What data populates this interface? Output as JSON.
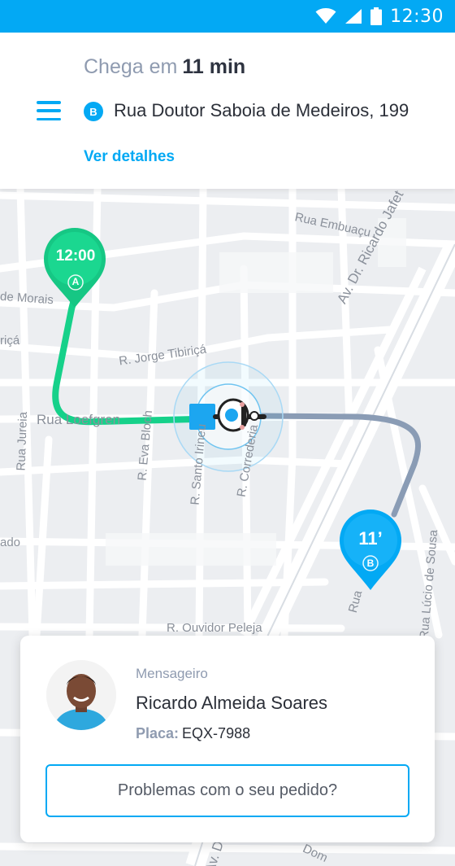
{
  "status_bar": {
    "time": "12:30",
    "icons": [
      "wifi-icon",
      "signal-icon",
      "battery-icon"
    ]
  },
  "header": {
    "eta_prefix": "Chega em",
    "eta_value": "11 min",
    "menu_icon": "hamburger-menu-icon",
    "destination_badge": "B",
    "destination_address": "Rua Doutor Saboia de Medeiros, 199",
    "details_link": "Ver detalhes"
  },
  "map": {
    "origin_pin": {
      "time": "12:00",
      "letter": "A",
      "color": "#16c784"
    },
    "destination_pin": {
      "eta": "11’",
      "letter": "B",
      "color": "#03a9f4"
    },
    "colors": {
      "traveled_route": "#16d18a",
      "remaining_route": "#8a9cb5",
      "accent": "#03a9f4"
    },
    "courier_icon": "motorcycle-courier-icon",
    "street_labels": {
      "rua_embuacu": "Rua Embuaçu",
      "av_ricardo_jafet": "Av. Dr. Ricardo Jafet",
      "de_morais": "de Morais",
      "tibirica_left": "riçá",
      "r_jorge_tibirica": "R. Jorge Tibiriçá",
      "rua_loefgren": "Rua Loefgren",
      "rua_jureia": "Rua Jureia",
      "r_eva_bloch": "R. Eva Bloch",
      "r_santo_irineu": "R. Santo Irineu",
      "r_correderia": "R. Correderia",
      "ado": "ado",
      "r_ouvidor_peleja": "R. Ouvidor Peleja",
      "rua_bottom": "Rua",
      "rua_lucio_de_sousa": "Rua Lúcio de Sousa",
      "av_bottom": "Av. D",
      "dom": "Dom"
    }
  },
  "courier": {
    "role_label": "Mensageiro",
    "name": "Ricardo Almeida Soares",
    "plate_label": "Placa:",
    "plate_value": "EQX-7988",
    "avatar_icon": "courier-avatar-photo"
  },
  "actions": {
    "problem_button": "Problemas com o seu pedido?"
  }
}
